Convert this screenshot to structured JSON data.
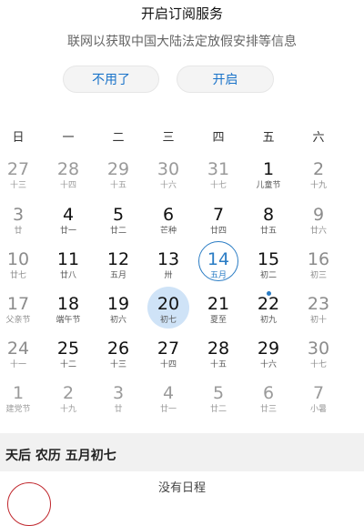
{
  "banner": {
    "title": "开启订阅服务",
    "description": "联网以获取中国大陆法定放假安排等信息",
    "decline_label": "不用了",
    "enable_label": "开启"
  },
  "weekdays": [
    "日",
    "一",
    "二",
    "三",
    "四",
    "五",
    "六"
  ],
  "weeks": [
    [
      {
        "num": "27",
        "lunar": "十三",
        "other": true
      },
      {
        "num": "28",
        "lunar": "十四",
        "other": true
      },
      {
        "num": "29",
        "lunar": "十五",
        "other": true
      },
      {
        "num": "30",
        "lunar": "十六",
        "other": true
      },
      {
        "num": "31",
        "lunar": "十七",
        "other": true
      },
      {
        "num": "1",
        "lunar": "儿童节"
      },
      {
        "num": "2",
        "lunar": "十九"
      }
    ],
    [
      {
        "num": "3",
        "lunar": "廿"
      },
      {
        "num": "4",
        "lunar": "廿一"
      },
      {
        "num": "5",
        "lunar": "廿二"
      },
      {
        "num": "6",
        "lunar": "芒种"
      },
      {
        "num": "7",
        "lunar": "廿四"
      },
      {
        "num": "8",
        "lunar": "廿五"
      },
      {
        "num": "9",
        "lunar": "廿六"
      }
    ],
    [
      {
        "num": "10",
        "lunar": "廿七"
      },
      {
        "num": "11",
        "lunar": "廿八"
      },
      {
        "num": "12",
        "lunar": "五月"
      },
      {
        "num": "13",
        "lunar": "卅"
      },
      {
        "num": "14",
        "lunar": "五月",
        "today": true
      },
      {
        "num": "15",
        "lunar": "初二",
        "dot": true
      },
      {
        "num": "16",
        "lunar": "初三"
      }
    ],
    [
      {
        "num": "17",
        "lunar": "父亲节"
      },
      {
        "num": "18",
        "lunar": "端午节"
      },
      {
        "num": "19",
        "lunar": "初六"
      },
      {
        "num": "20",
        "lunar": "初七",
        "selected": true
      },
      {
        "num": "21",
        "lunar": "夏至"
      },
      {
        "num": "22",
        "lunar": "初九"
      },
      {
        "num": "23",
        "lunar": "初十"
      }
    ],
    [
      {
        "num": "24",
        "lunar": "十一"
      },
      {
        "num": "25",
        "lunar": "十二"
      },
      {
        "num": "26",
        "lunar": "十三"
      },
      {
        "num": "27",
        "lunar": "十四"
      },
      {
        "num": "28",
        "lunar": "十五"
      },
      {
        "num": "29",
        "lunar": "十六"
      },
      {
        "num": "30",
        "lunar": "十七"
      }
    ],
    [
      {
        "num": "1",
        "lunar": "建党节",
        "other": true
      },
      {
        "num": "2",
        "lunar": "十九",
        "other": true
      },
      {
        "num": "3",
        "lunar": "廿",
        "other": true
      },
      {
        "num": "4",
        "lunar": "廿一",
        "other": true
      },
      {
        "num": "5",
        "lunar": "廿二",
        "other": true
      },
      {
        "num": "6",
        "lunar": "廿三",
        "other": true
      },
      {
        "num": "7",
        "lunar": "小暑",
        "other": true
      }
    ]
  ],
  "info": {
    "text": "天后  农历 五月初七"
  },
  "schedule": {
    "empty_label": "没有日程"
  },
  "colors": {
    "accent": "#2a7cc4",
    "selected_bg": "#cfe3f7"
  }
}
